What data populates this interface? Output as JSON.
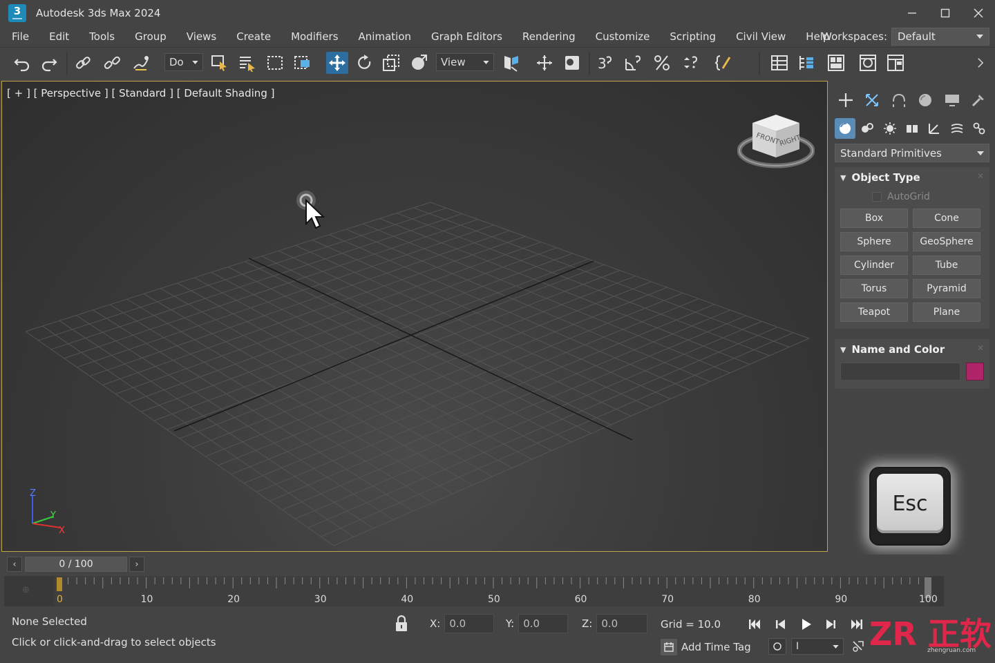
{
  "window": {
    "title": "Autodesk 3ds Max 2024",
    "logo_text": "3",
    "controls": [
      "minimize-icon",
      "maximize-icon",
      "close-icon"
    ]
  },
  "menu": {
    "items": [
      "File",
      "Edit",
      "Tools",
      "Group",
      "Views",
      "Create",
      "Modifiers",
      "Animation",
      "Graph Editors",
      "Rendering",
      "Customize",
      "Scripting",
      "Civil View",
      "Help"
    ],
    "workspaces_label": "Workspaces:",
    "workspaces_value": "Default"
  },
  "toolbar": {
    "selection_filter": "Do",
    "reference_coord": "View",
    "icons": [
      "undo-icon",
      "redo-icon",
      "link-icon",
      "unlink-icon",
      "bind-space-warp-icon",
      "select-object-icon",
      "select-by-name-icon",
      "rect-selection-icon",
      "window-crossing-icon",
      "move-icon",
      "rotate-icon",
      "scale-icon",
      "place-icon",
      "pivot-icon",
      "mirror-icon",
      "snap-3d-icon",
      "angle-snap-icon",
      "percent-snap-icon",
      "spinner-snap-icon",
      "edit-named-selection-icon",
      "scene-explorer-icon",
      "layer-explorer-icon",
      "toggle-ribbon-icon",
      "render-setup-icon",
      "render-frame-icon",
      "more-icon"
    ]
  },
  "viewport": {
    "label": "[ + ] [ Perspective ] [ Standard ] [ Default Shading ]",
    "viewcube": {
      "front": "FRONT",
      "right": "RIGHT"
    },
    "axes": {
      "x": "X",
      "y": "Y",
      "z": "Z"
    },
    "border_color": "#c4a54a"
  },
  "command_panel": {
    "tabs": [
      "create-icon",
      "modify-icon",
      "hierarchy-icon",
      "motion-icon",
      "display-icon",
      "utilities-icon"
    ],
    "subtabs": [
      "geometry-icon",
      "shapes-icon",
      "lights-icon",
      "cameras-icon",
      "helpers-icon",
      "space-warps-icon",
      "systems-icon"
    ],
    "category": "Standard Primitives",
    "object_type": {
      "title": "Object Type",
      "autogrid": "AutoGrid",
      "buttons": [
        "Box",
        "Cone",
        "Sphere",
        "GeoSphere",
        "Cylinder",
        "Tube",
        "Torus",
        "Pyramid",
        "Teapot",
        "Plane"
      ]
    },
    "name_color": {
      "title": "Name and Color",
      "name_value": "",
      "swatch_color": "#b0246a"
    }
  },
  "keyboard_overlay": {
    "key": "Esc"
  },
  "time_slider": {
    "frame_display": "0 / 100",
    "ticks": [
      "0",
      "10",
      "20",
      "30",
      "40",
      "50",
      "60",
      "70",
      "80",
      "90",
      "100"
    ],
    "current_frame": 0
  },
  "status": {
    "selection": "None Selected",
    "hint": "Click or click-and-drag to select objects",
    "x_label": "X:",
    "x_value": "0.0",
    "y_label": "Y:",
    "y_value": "0.0",
    "z_label": "Z:",
    "z_value": "0.0",
    "grid": "Grid = 10.0",
    "add_time_tag": "Add Time Tag",
    "frame_field": "I"
  },
  "watermark": {
    "text": "ZR 正软",
    "sub": "zhengruan.com"
  }
}
